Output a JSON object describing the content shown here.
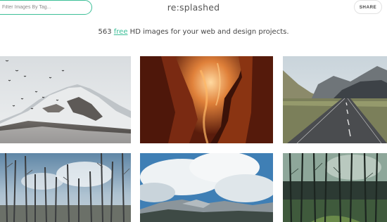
{
  "header": {
    "search_placeholder": "Filter Images By Tag...",
    "logo": "re:splashed",
    "share_label": "SHARE"
  },
  "tagline": {
    "count": "563",
    "highlight": "free",
    "rest": "HD images for your web and design projects."
  },
  "colors": {
    "accent": "#3dbf98"
  },
  "gallery": [
    {
      "subject": "snowy mountain with birds"
    },
    {
      "subject": "canyon"
    },
    {
      "subject": "road and mountains"
    },
    {
      "subject": "burnt forest"
    },
    {
      "subject": "clouds over mountain"
    },
    {
      "subject": "dense forest"
    }
  ]
}
